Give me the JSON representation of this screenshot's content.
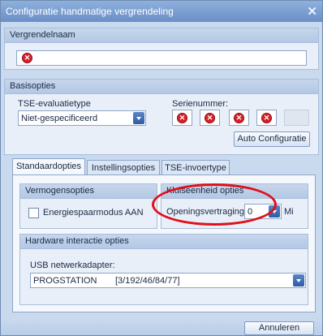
{
  "window": {
    "title": "Configuratie handmatige vergrendeling"
  },
  "name_section": {
    "header": "Vergrendelnaam"
  },
  "basic_section": {
    "header": "Basisopties",
    "tse_label": "TSE-evaluatietype",
    "tse_value": "Niet-gespecificeerd",
    "serial_label": "Serienummer:",
    "auto_config_label": "Auto Configuratie"
  },
  "tabs": [
    {
      "label": "Standaardopties"
    },
    {
      "label": "Instellingsopties"
    },
    {
      "label": "TSE-invoertype"
    }
  ],
  "standard_tab": {
    "capacity_header": "Vermogensopties",
    "energy_checkbox_label": "Energiespaarmodus AAN",
    "vault_header": "Kluiseenheid opties",
    "opening_delay_label": "Openingsvertraging",
    "opening_delay_value": "0",
    "opening_delay_unit": "Mi",
    "hardware_header": "Hardware interactie opties",
    "usb_label": "USB netwerkadapter:",
    "usb_value_name": "PROGSTATION",
    "usb_value_path": "[3/192/46/84/77]"
  },
  "footer": {
    "cancel_label": "Annuleren"
  },
  "colors": {
    "error": "#d8202a",
    "highlight_oval": "#e0101a",
    "title_bar": "#7a9bd0"
  },
  "icons": {
    "error": "error-icon",
    "close": "close-icon",
    "dropdown": "chevron-down-icon"
  }
}
